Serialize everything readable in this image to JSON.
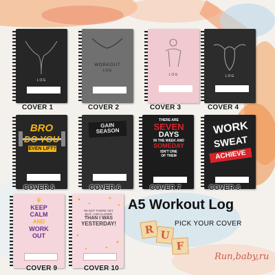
{
  "product": {
    "title": "A5  Workout Log",
    "cta": "PICK YOUR COVER",
    "decor_text": "Run,baby,ru",
    "tile_letters": [
      "R",
      "U",
      "F"
    ]
  },
  "covers": [
    {
      "label": "COVER 1",
      "text": "LOG"
    },
    {
      "label": "COVER 2",
      "text_line1": "WORKOUT",
      "text_line2": "LOG"
    },
    {
      "label": "COVER 3",
      "text": "LOG"
    },
    {
      "label": "COVER 4",
      "text": "LOG"
    },
    {
      "label": "COVER 5",
      "text_line1": "BRO",
      "text_line2": "DO YOU",
      "text_line3": "EVEN LIFT?"
    },
    {
      "label": "COVER 6",
      "text_line1": "GAIN",
      "text_line2": "SEASON"
    },
    {
      "label": "COVER 7",
      "text_line1": "THERE ARE",
      "text_line2": "SEVEN",
      "text_line3": "DAYS",
      "text_line4": "IN THE WEEK AND",
      "text_line5": "SOMEDAY",
      "text_line6": "ISN'T ONE",
      "text_line7": "OF THEM"
    },
    {
      "label": "COVER 8",
      "text_line1": "WORK",
      "text_line2": "SWEAT",
      "text_line3": "ACHIEVE"
    },
    {
      "label": "COVER 9",
      "text_line1": "KEEP",
      "text_line2": "CALM",
      "text_line3": "AND",
      "text_line4": "WORK",
      "text_line5": "OUT"
    },
    {
      "label": "COVER 10",
      "text_line1": "I'M NOT THERE YET,",
      "text_line2": "BUT, I AM CLOSER",
      "text_line3": "THAN I WAS",
      "text_line4": "YESTERDAY!"
    }
  ],
  "colors": {
    "cover_dark": "#2b2b2b",
    "cover_grey": "#6f6f6f",
    "cover_pink": "#f1c9d0",
    "cover_yellow_accent": "#f3b316",
    "cover_red_accent": "#d8232a",
    "cover_purple_accent": "#6b2f8f"
  }
}
